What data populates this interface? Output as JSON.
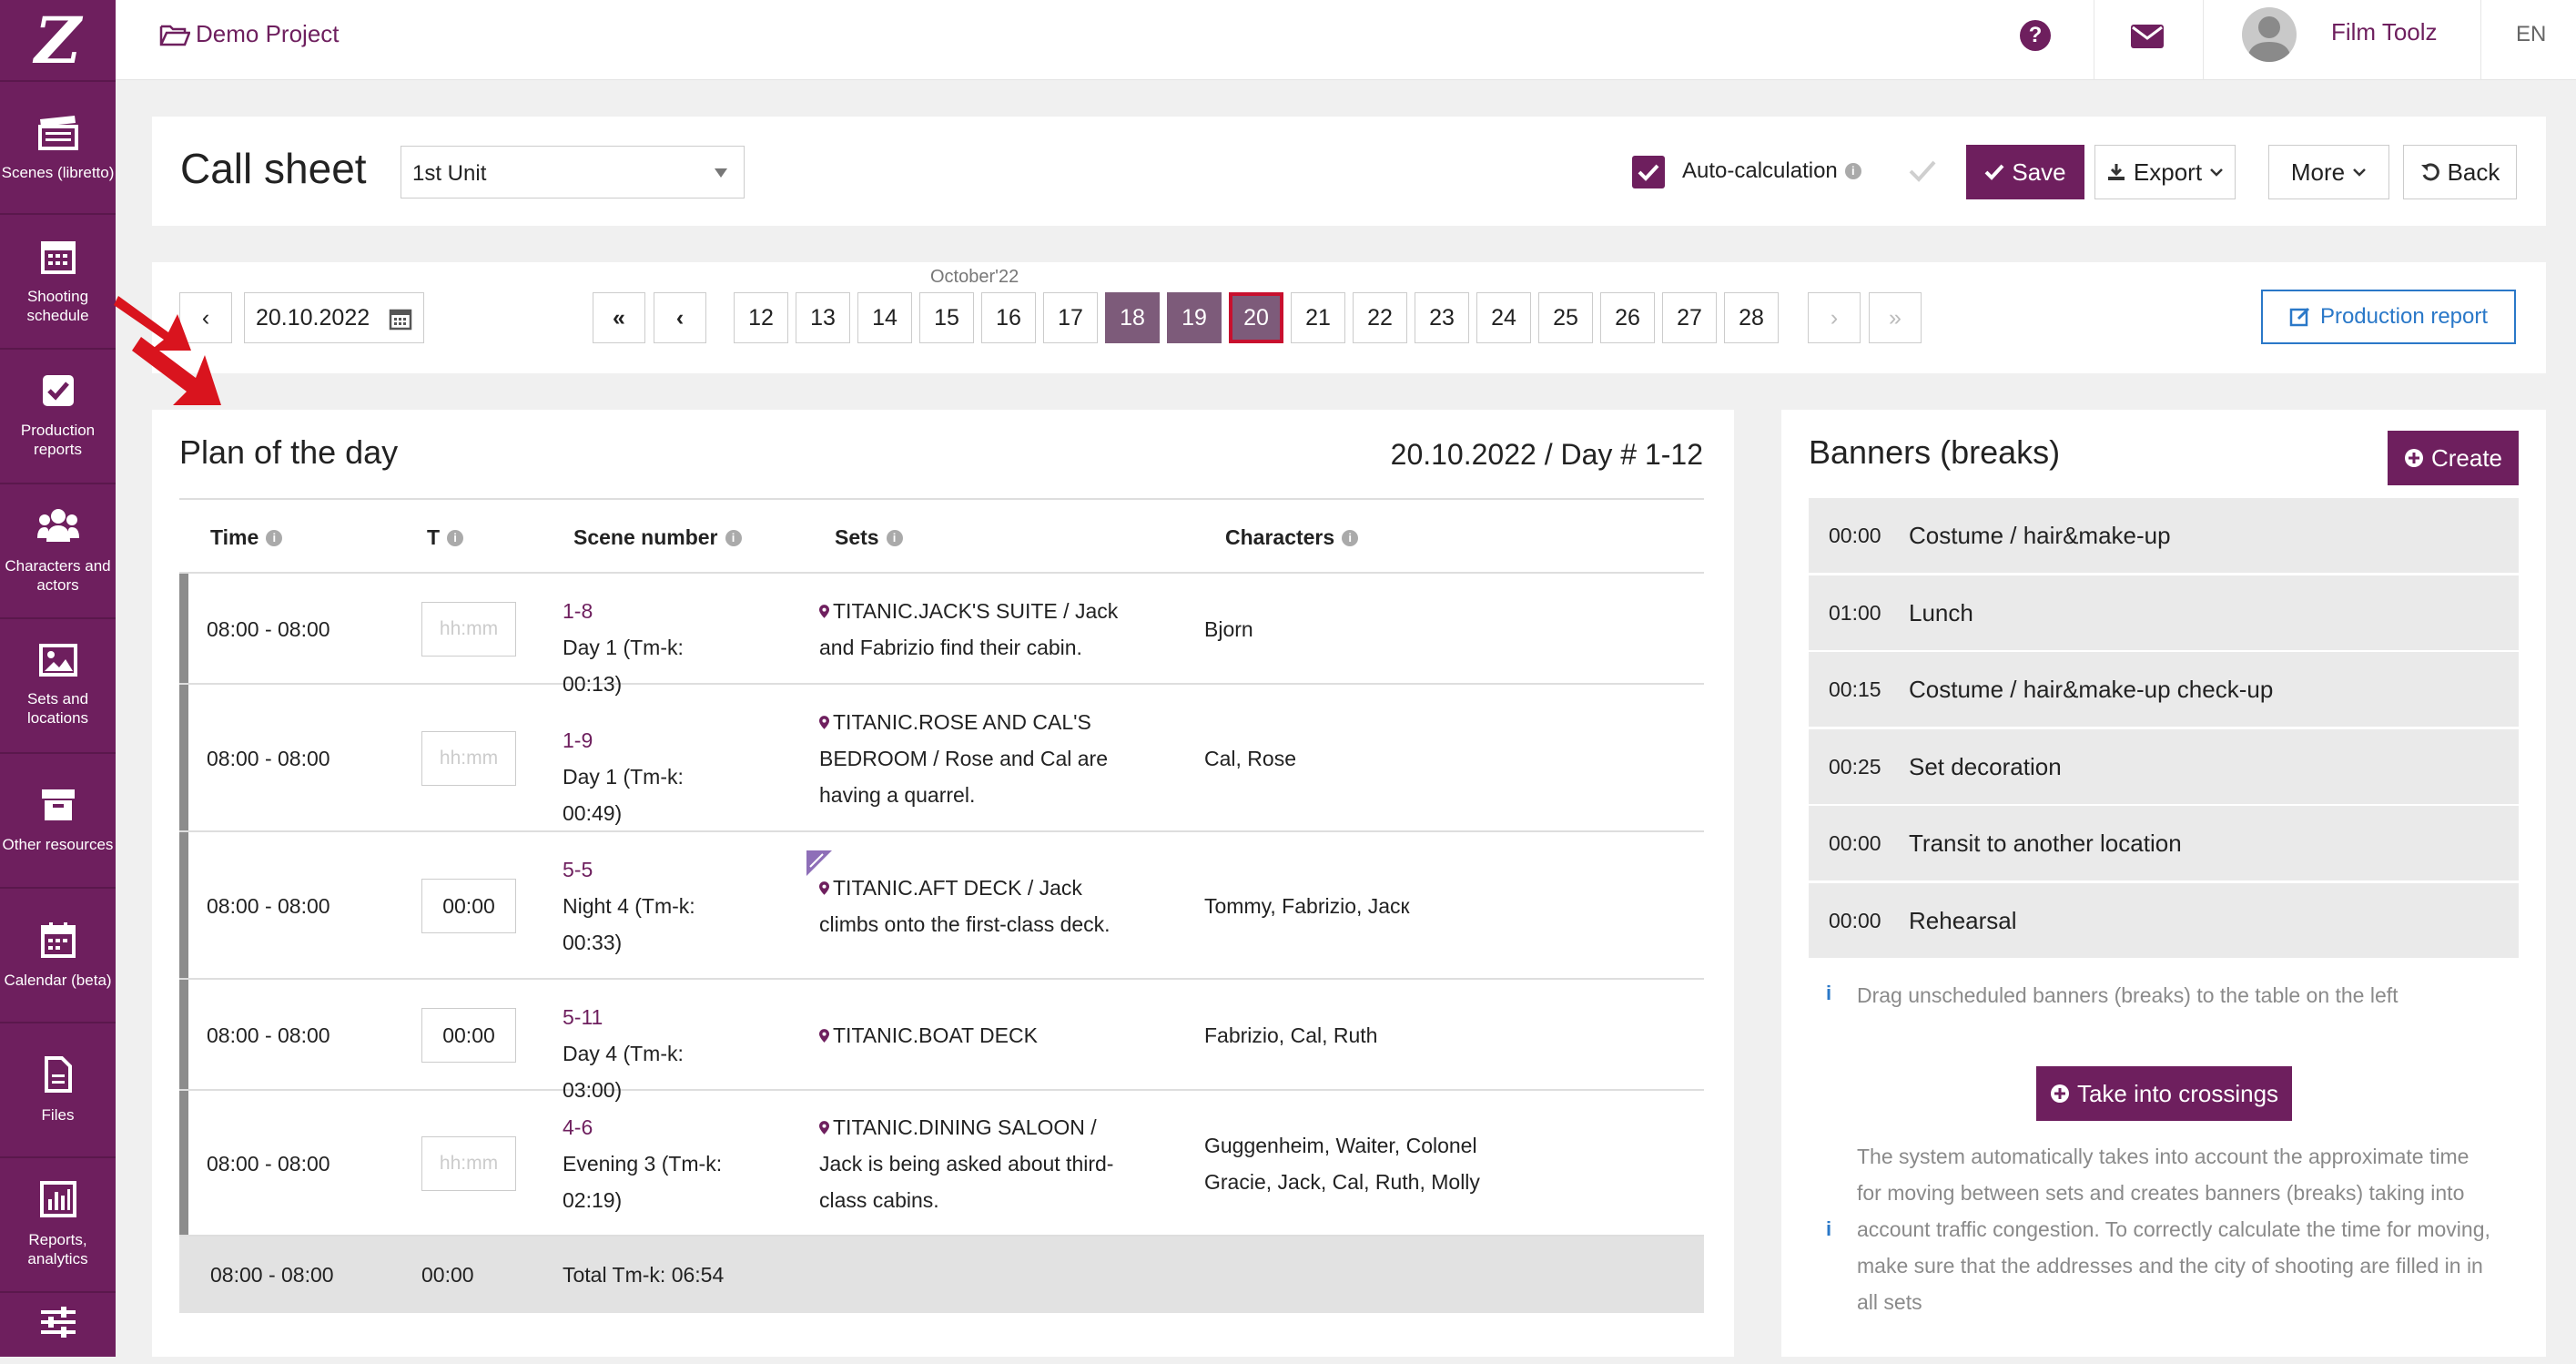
{
  "sidebar": {
    "logo": "Z",
    "items": [
      {
        "label": "Scenes (libretto)",
        "icon": "clapperboard-icon"
      },
      {
        "label": "Shooting schedule",
        "icon": "calendar-grid-icon"
      },
      {
        "label": "Production reports",
        "icon": "checkbox-icon"
      },
      {
        "label": "Characters and actors",
        "icon": "users-icon"
      },
      {
        "label": "Sets and locations",
        "icon": "image-icon"
      },
      {
        "label": "Other resources",
        "icon": "archive-icon"
      },
      {
        "label": "Calendar (beta)",
        "icon": "calendar-icon"
      },
      {
        "label": "Files",
        "icon": "file-icon"
      },
      {
        "label": "Reports, analytics",
        "icon": "bar-chart-icon"
      },
      {
        "label": "",
        "icon": "sliders-icon"
      }
    ]
  },
  "topbar": {
    "project": "Demo Project",
    "user": "Film Toolz",
    "lang": "EN"
  },
  "header": {
    "title": "Call sheet",
    "unit": "1st Unit",
    "auto_calc": "Auto-calculation",
    "auto_calc_checked": true,
    "save": "Save",
    "export": "Export",
    "more": "More",
    "back": "Back"
  },
  "datenav": {
    "date": "20.10.2022",
    "month": "October'22",
    "first": "«",
    "prev": "‹",
    "next": "›",
    "last": "»",
    "prev_day": "‹",
    "days": [
      "12",
      "13",
      "14",
      "15",
      "16",
      "17",
      "18",
      "19",
      "20",
      "21",
      "22",
      "23",
      "24",
      "25",
      "26",
      "27",
      "28"
    ],
    "selected_days": [
      "18",
      "19"
    ],
    "today": "20",
    "production_report": "Production report"
  },
  "plan": {
    "title": "Plan of the day",
    "subtitle": "20.10.2022 / Day # 1-12",
    "columns": {
      "time": "Time",
      "t": "T",
      "scene": "Scene number",
      "sets": "Sets",
      "characters": "Characters"
    },
    "rows": [
      {
        "time": "08:00 - 08:00",
        "t": "",
        "t_placeholder": "hh:mm",
        "scene_no": "1-8",
        "scene_info": [
          "Day 1 (Tm-k: 00:13)"
        ],
        "sets": [
          "TITANIC.JACK'S SUITE / Jack",
          "and Fabrizio find their cabin."
        ],
        "characters": [
          "Bjorn"
        ]
      },
      {
        "time": "08:00 - 08:00",
        "t": "",
        "t_placeholder": "hh:mm",
        "scene_no": "1-9",
        "scene_info": [
          "Day 1 (Tm-k: 00:49)"
        ],
        "sets": [
          "TITANIC.ROSE AND CAL'S",
          "BEDROOM / Rose and Cal are",
          "having a quarrel."
        ],
        "characters": [
          "Cal, Rose"
        ]
      },
      {
        "time": "08:00 - 08:00",
        "t": "00:00",
        "t_placeholder": "",
        "scene_no": "5-5",
        "scene_info": [
          "Night 4 (Tm-k:",
          "00:33)"
        ],
        "sets": [
          "TITANIC.AFT DECK / Jack",
          "climbs onto the first-class deck."
        ],
        "characters": [
          "Tommy, Fabrizio, Jacк"
        ]
      },
      {
        "time": "08:00 - 08:00",
        "t": "00:00",
        "t_placeholder": "",
        "scene_no": "5-11",
        "scene_info": [
          "Day 4 (Tm-k: 03:00)"
        ],
        "sets": [
          "TITANIC.BOAT DECK"
        ],
        "characters": [
          "Fabrizio, Cal, Ruth"
        ]
      },
      {
        "time": "08:00 - 08:00",
        "t": "",
        "t_placeholder": "hh:mm",
        "scene_no": "4-6",
        "scene_info": [
          "Evening 3 (Tm-k:",
          "02:19)"
        ],
        "sets": [
          "TITANIC.DINING SALOON /",
          "Jack is being asked about third-",
          "class cabins."
        ],
        "characters": [
          "Guggenheim, Waiter, Colonel",
          "Gracie, Jack, Cal, Ruth, Molly"
        ]
      }
    ],
    "total": {
      "time": "08:00 - 08:00",
      "t": "00:00",
      "label": "Total Tm-k: 06:54"
    }
  },
  "banners": {
    "title": "Banners (breaks)",
    "create": "Create",
    "items": [
      {
        "time": "00:00",
        "label": "Costume / hair&make-up"
      },
      {
        "time": "01:00",
        "label": "Lunch"
      },
      {
        "time": "00:15",
        "label": "Costume / hair&make-up check-up"
      },
      {
        "time": "00:25",
        "label": "Set decoration"
      },
      {
        "time": "00:00",
        "label": "Transit to another location"
      },
      {
        "time": "00:00",
        "label": "Rehearsal"
      }
    ],
    "drag_hint": "Drag unscheduled banners (breaks) to the table on the left",
    "take_into_crossings": "Take into crossings",
    "system_note": [
      "The system automatically takes into account the approximate time",
      "for moving between sets and creates banners (breaks) taking into",
      "account traffic congestion. To correctly calculate the time for moving,",
      "make sure that the addresses and the city of shooting are filled in in",
      "all sets"
    ]
  },
  "colors": {
    "brand": "#6e1f5e",
    "selected_day": "#7d5b7a",
    "today_border": "#c8102e",
    "link_blue": "#2a78c8"
  }
}
